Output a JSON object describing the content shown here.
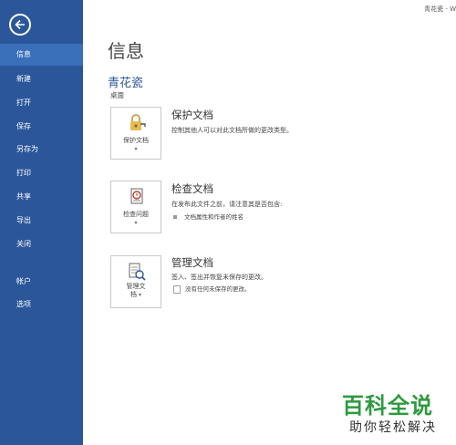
{
  "window": {
    "title": "青花瓷 - W"
  },
  "sidebar": {
    "items": [
      {
        "label": "信息",
        "active": true
      },
      {
        "label": "新建"
      },
      {
        "label": "打开"
      },
      {
        "label": "保存"
      },
      {
        "label": "另存为"
      },
      {
        "label": "打印"
      },
      {
        "label": "共享"
      },
      {
        "label": "导出"
      },
      {
        "label": "关闭"
      },
      {
        "label": "帐户"
      },
      {
        "label": "选项"
      }
    ]
  },
  "main": {
    "title": "信息",
    "doc_name": "青花瓷",
    "doc_location": "桌面",
    "sections": [
      {
        "button_label": "保护文档",
        "title": "保护文档",
        "description": "控制其他人可以对此文档所做的更改类型。",
        "icon": "lock-key-icon"
      },
      {
        "button_label": "检查问题",
        "title": "检查文档",
        "description": "在发布此文件之前，请注意其是否包含:",
        "bullets": [
          "文档属性和作者的姓名"
        ],
        "icon": "inspect-document-icon"
      },
      {
        "button_label_line1": "管理文",
        "button_label_line2": "档",
        "title": "管理文档",
        "description": "签入、签出并恢复未保存的更改。",
        "note": "没有任何未保存的更改。",
        "icon": "manage-document-icon"
      }
    ]
  },
  "watermark": {
    "line1": "百科全说",
    "line2": "助你轻松解决"
  },
  "colors": {
    "sidebar": "#2b579a",
    "sidebar_active": "#3a6fba",
    "accent": "#2b579a",
    "watermark_green": "#2e9a3e"
  }
}
